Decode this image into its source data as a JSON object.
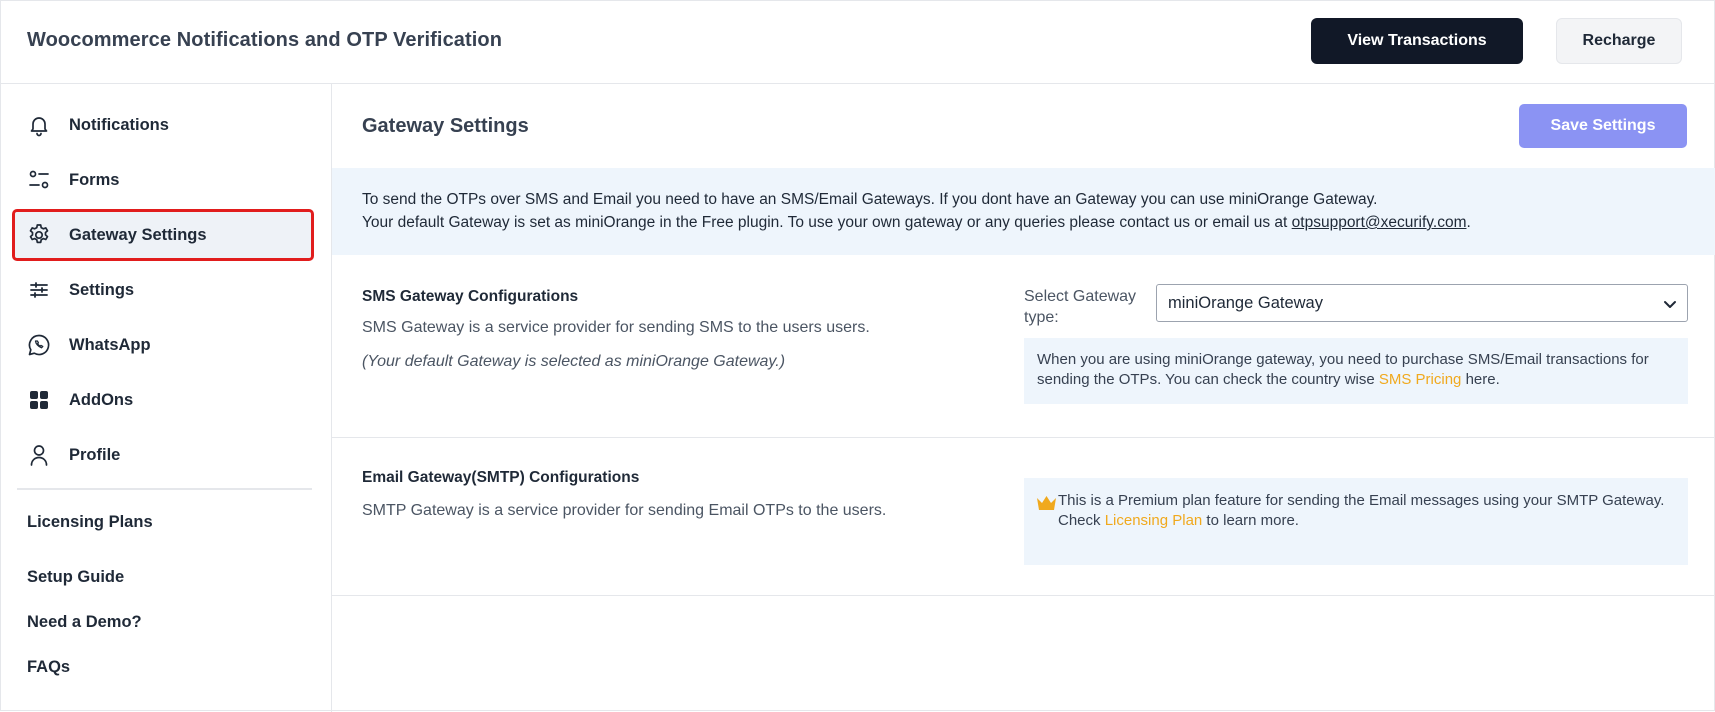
{
  "header": {
    "title": "Woocommerce Notifications and OTP Verification",
    "view_transactions": "View Transactions",
    "recharge": "Recharge"
  },
  "sidebar": {
    "items": [
      {
        "label": "Notifications",
        "icon": "bell-icon"
      },
      {
        "label": "Forms",
        "icon": "forms-icon"
      },
      {
        "label": "Gateway Settings",
        "icon": "gear-icon",
        "active": true
      },
      {
        "label": "Settings",
        "icon": "sliders-icon"
      },
      {
        "label": "WhatsApp",
        "icon": "whatsapp-icon"
      },
      {
        "label": "AddOns",
        "icon": "grid-icon"
      },
      {
        "label": "Profile",
        "icon": "user-icon"
      }
    ],
    "links": [
      "Licensing Plans",
      "Setup Guide",
      "Need a Demo?",
      "FAQs"
    ]
  },
  "main": {
    "title": "Gateway Settings",
    "save_label": "Save Settings",
    "banner": {
      "line1": "To send the OTPs over SMS and Email you need to have an SMS/Email Gateways. If you dont have an Gateway you can use miniOrange Gateway.",
      "line2_prefix": "Your default Gateway is set as miniOrange in the Free plugin. To use your own gateway or any queries please contact us or email us at ",
      "email": "otpsupport@xecurify.com",
      "line2_suffix": "."
    },
    "sms": {
      "title": "SMS Gateway Configurations",
      "desc": "SMS Gateway is a service provider for sending SMS to the users users.",
      "note": "(Your default Gateway is selected as miniOrange Gateway.)",
      "select_label": "Select Gateway type:",
      "select_value": "miniOrange Gateway",
      "info_prefix": "When you are using miniOrange gateway, you need to purchase SMS/Email transactions for sending the OTPs. You can check the country wise ",
      "info_link": "SMS Pricing",
      "info_suffix": " here."
    },
    "email": {
      "title": "Email Gateway(SMTP) Configurations",
      "desc": "SMTP Gateway is a service provider for sending Email OTPs to the users.",
      "premium_text": "This is a Premium plan feature for sending the Email messages using your SMTP Gateway.",
      "check_prefix": "Check ",
      "check_link": "Licensing Plan",
      "check_suffix": " to learn more."
    }
  },
  "colors": {
    "accent": "#8b93f3",
    "dark_button": "#111827",
    "highlight_border": "#e11d1d",
    "info_bg": "#eef5fc",
    "link_orange": "#f0a91e"
  }
}
